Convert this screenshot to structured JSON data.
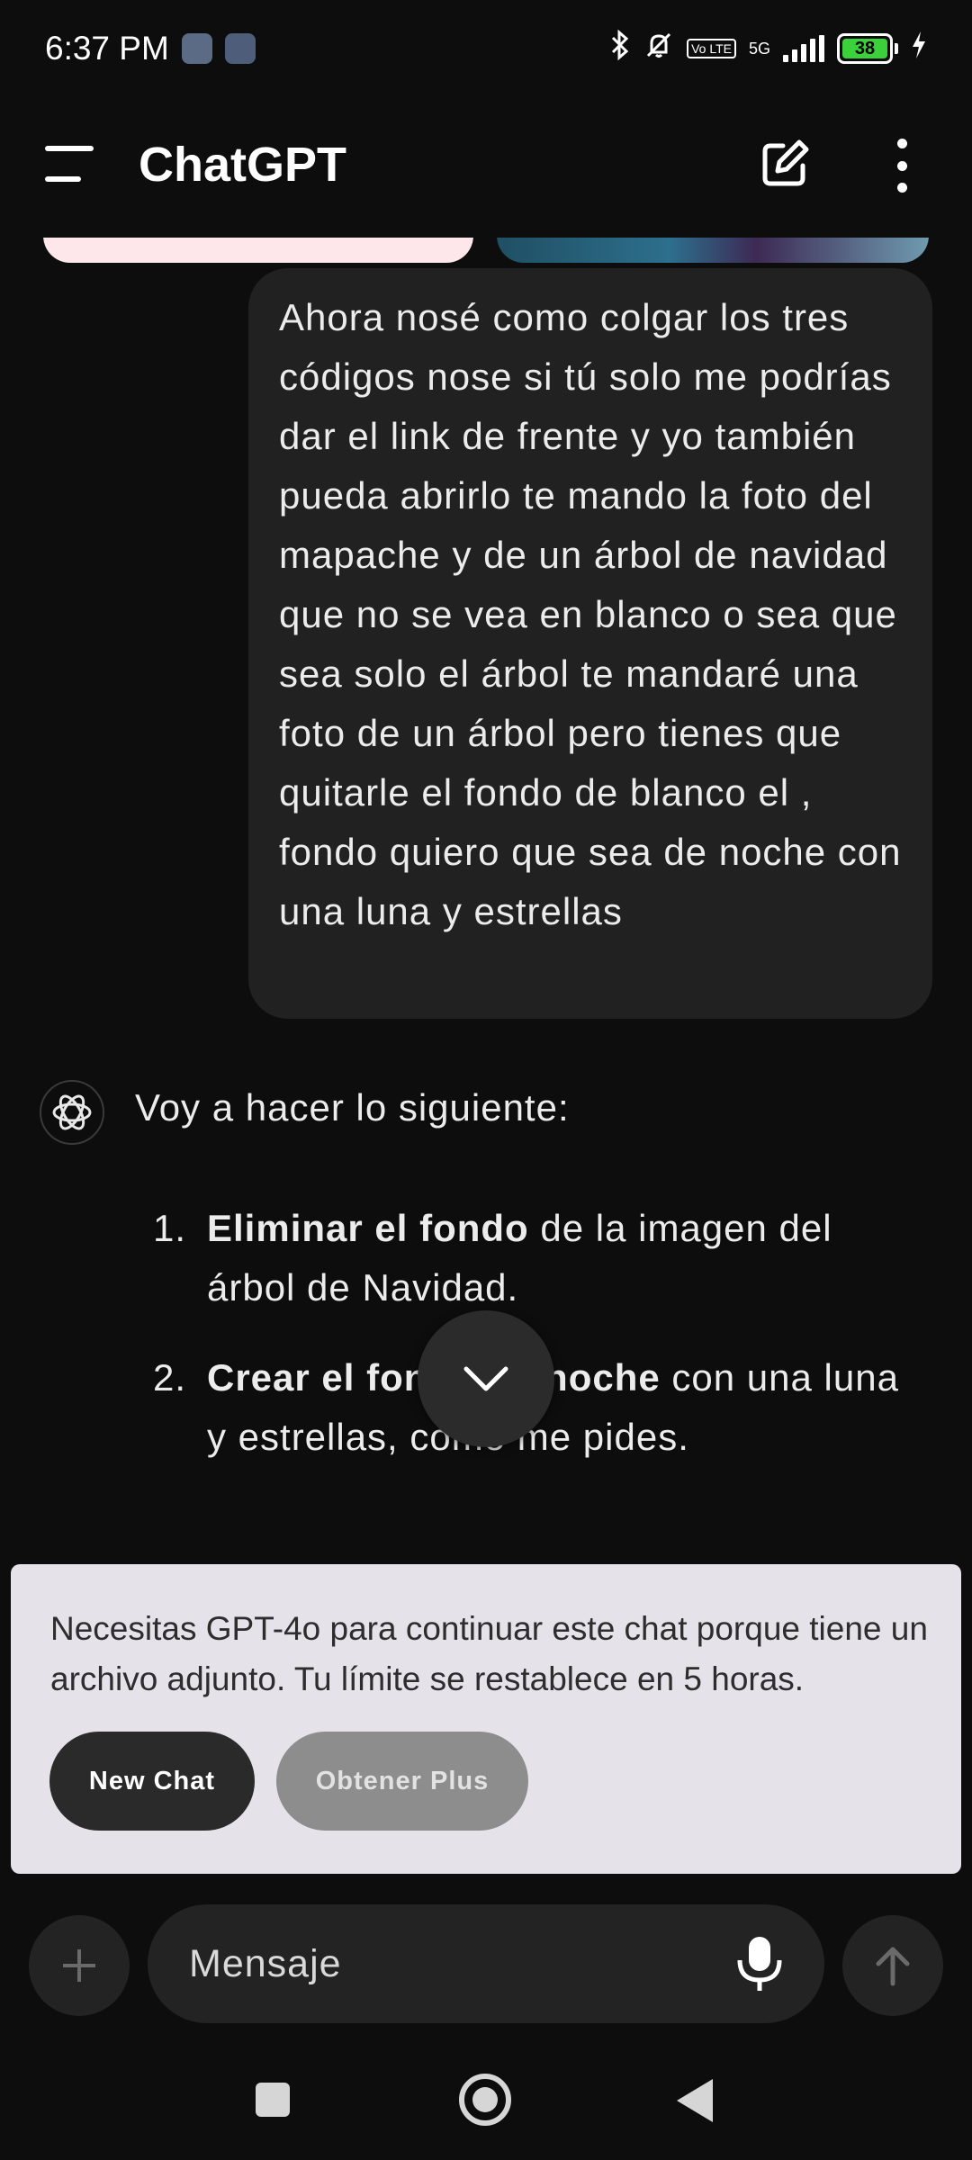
{
  "status_bar": {
    "time": "6:37 PM",
    "network_label": "5G",
    "volte_label": "Vo LTE",
    "battery_level": "38",
    "battery_percent": 38,
    "battery_color": "#3ad13a",
    "icons": [
      "bluetooth-icon",
      "notifications-muted-icon",
      "signal-icon",
      "battery-icon",
      "charging-icon"
    ]
  },
  "app_bar": {
    "title": "ChatGPT",
    "icons": [
      "menu-icon",
      "new-chat-icon",
      "more-options-icon"
    ]
  },
  "conversation": {
    "user_message": "Ahora nosé como colgar los tres códigos nose si tú solo me podrías dar el link de frente y yo también pueda abrirlo te mando la foto del mapache y de un árbol de navidad que no se vea en blanco o sea que sea solo el árbol te mandaré una foto de un árbol pero tienes que quitarle el fondo de blanco el , fondo quiero que sea de noche con una luna y estrellas",
    "assistant_intro": "Voy a hacer lo siguiente:",
    "steps": [
      {
        "number": "1.",
        "bold": "Eliminar el fondo",
        "rest": " de la imagen del árbol de Navidad."
      },
      {
        "number": "2.",
        "bold": "Crear el fondo de noche",
        "rest": " con una luna y estrellas, como me pides."
      }
    ]
  },
  "limit_banner": {
    "text": "Necesitas GPT-4o para continuar este chat porque tiene un archivo adjunto. Tu límite se restablece en 5 horas.",
    "new_chat_label": "New Chat",
    "upgrade_label": "Obtener Plus"
  },
  "composer": {
    "placeholder": "Mensaje",
    "icons": [
      "add-icon",
      "microphone-icon",
      "send-arrow-icon"
    ]
  },
  "nav_bar": {
    "icons": [
      "recents-icon",
      "home-icon",
      "back-icon"
    ]
  }
}
